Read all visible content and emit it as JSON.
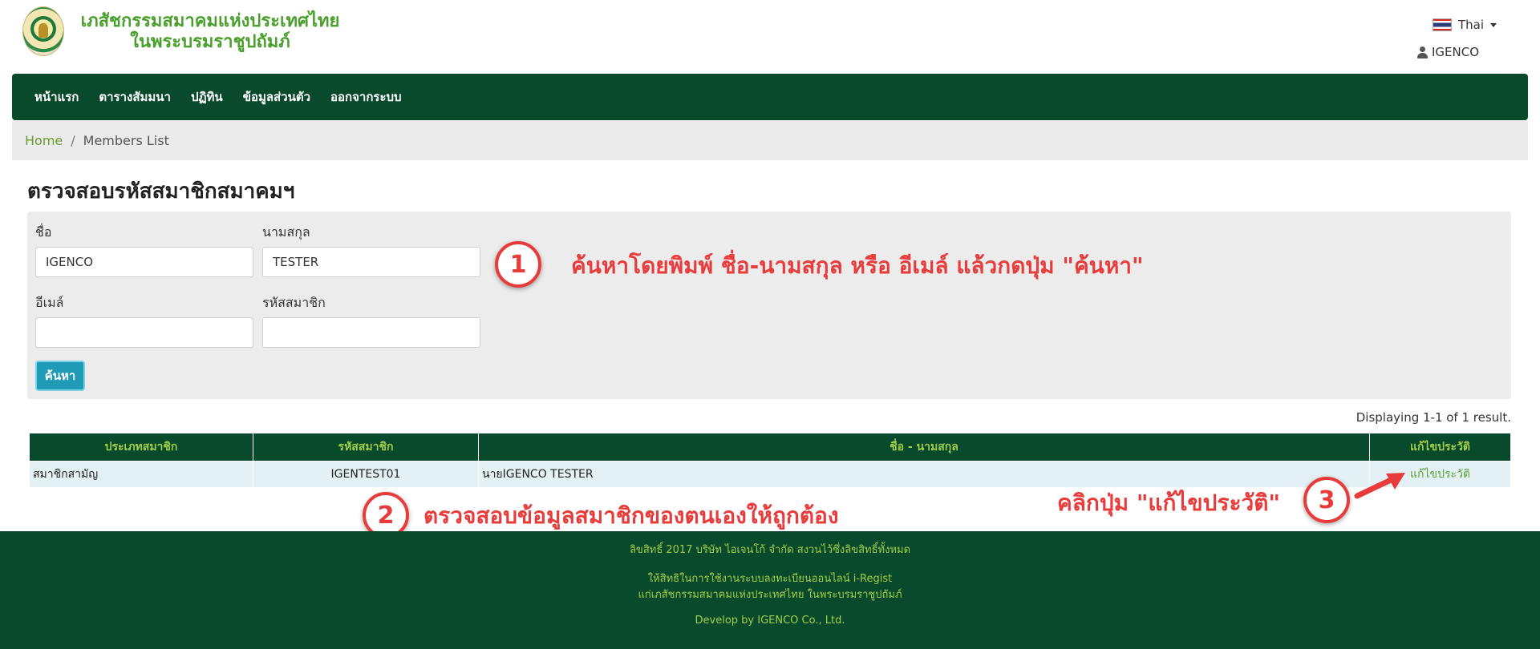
{
  "header": {
    "title_line1": "เภสัชกรรมสมาคมแห่งประเทศไทย",
    "title_line2": "ในพระบรมราชูปถัมภ์",
    "language": "Thai",
    "username": "IGENCO"
  },
  "nav": {
    "items": [
      "หน้าแรก",
      "ตารางสัมมนา",
      "ปฏิทิน",
      "ข้อมูลส่วนตัว",
      "ออกจากระบบ"
    ]
  },
  "breadcrumb": {
    "home": "Home",
    "separator": "/",
    "current": "Members List"
  },
  "page": {
    "title": "ตรวจสอบรหัสสมาชิกสมาคมฯ"
  },
  "search": {
    "first_name_label": "ชื่อ",
    "first_name_value": "IGENCO",
    "last_name_label": "นามสกุล",
    "last_name_value": "TESTER",
    "email_label": "อีเมล์",
    "email_value": "",
    "member_code_label": "รหัสสมาชิก",
    "member_code_value": "",
    "button_label": "ค้นหา"
  },
  "results": {
    "summary": "Displaying 1-1 of 1 result.",
    "columns": [
      "ประเภทสมาชิก",
      "รหัสสมาชิก",
      "ชื่อ - นามสกุล",
      "แก้ไขประวัติ"
    ],
    "rows": [
      {
        "type": "สมาชิกสามัญ",
        "code": "IGENTEST01",
        "name": "นายIGENCO TESTER",
        "action": "แก้ไขประวัติ"
      }
    ]
  },
  "annotations": {
    "step1_number": "1",
    "step1_text": "ค้นหาโดยพิมพ์ ชื่อ-นามสกุล หรือ อีเมล์ แล้วกดปุ่ม \"ค้นหา\"",
    "step2_number": "2",
    "step2_text": "ตรวจสอบข้อมูลสมาชิกของตนเองให้ถูกต้อง",
    "step3_number": "3",
    "step3_text": "คลิกปุ่ม \"แก้ไขประวัติ\"",
    "accent_color": "#e83b3b"
  },
  "footer": {
    "copyright": "ลิขสิทธิ์ 2017 บริษัท ไอเจนโก้ จำกัด สงวนไว้ซึ่งลิขสิทธิ์ทั้งหมด",
    "license_line1": "ให้สิทธิในการใช้งานระบบลงทะเบียนออนไลน์ i-Regist",
    "license_line2": "แก่เภสัชกรรมสมาคมแห่งประเทศไทย ในพระบรมราชูปถัมภ์",
    "developer": "Develop by IGENCO Co., Ltd."
  },
  "colors": {
    "primary_green": "#0a4a2c",
    "accent_green": "#9fce4a",
    "button_blue": "#1f9bb8"
  }
}
